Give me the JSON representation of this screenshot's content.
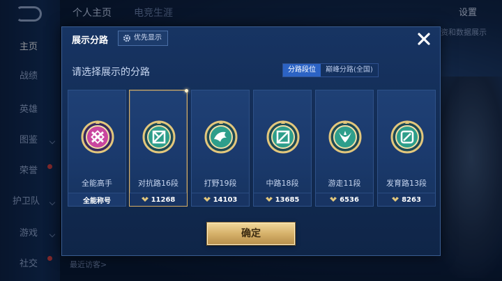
{
  "background": {
    "nav": {
      "items": [
        {
          "label": "主页",
          "active": true
        },
        {
          "label": "战绩"
        },
        {
          "label": "英雄"
        },
        {
          "label": "图鉴"
        },
        {
          "label": "荣誉"
        },
        {
          "label": "护卫队"
        },
        {
          "label": "游戏"
        },
        {
          "label": "社交"
        }
      ]
    },
    "top_tabs": [
      "个人主页",
      "电竞生涯"
    ],
    "settings_label": "设置",
    "right_text": "资和数据展示",
    "bottom_input_placeholder": "最近访客>"
  },
  "modal": {
    "title": "展示分路",
    "priority_button": "优先显示",
    "prompt": "请选择展示的分路",
    "segments": [
      {
        "label": "分路段位",
        "active": true
      },
      {
        "label": "巅峰分路(全国)",
        "active": false
      }
    ],
    "cards": [
      {
        "name": "全能高手",
        "footer": "全能称号",
        "has_score": false,
        "selected": false,
        "badge_color": "#c9469f"
      },
      {
        "name": "对抗路16段",
        "footer": "11268",
        "has_score": true,
        "selected": true,
        "badge_color": "#2e9e8b"
      },
      {
        "name": "打野19段",
        "footer": "14103",
        "has_score": true,
        "selected": false,
        "badge_color": "#2e9e8b"
      },
      {
        "name": "中路18段",
        "footer": "13685",
        "has_score": true,
        "selected": false,
        "badge_color": "#2e9e8b"
      },
      {
        "name": "游走11段",
        "footer": "6536",
        "has_score": true,
        "selected": false,
        "badge_color": "#2e9e8b"
      },
      {
        "name": "发育路13段",
        "footer": "8263",
        "has_score": true,
        "selected": false,
        "badge_color": "#2e9e8b"
      }
    ],
    "confirm_label": "确定"
  },
  "icons": {
    "close": "close-icon",
    "gear": "gear-icon",
    "score": "score-icon"
  }
}
